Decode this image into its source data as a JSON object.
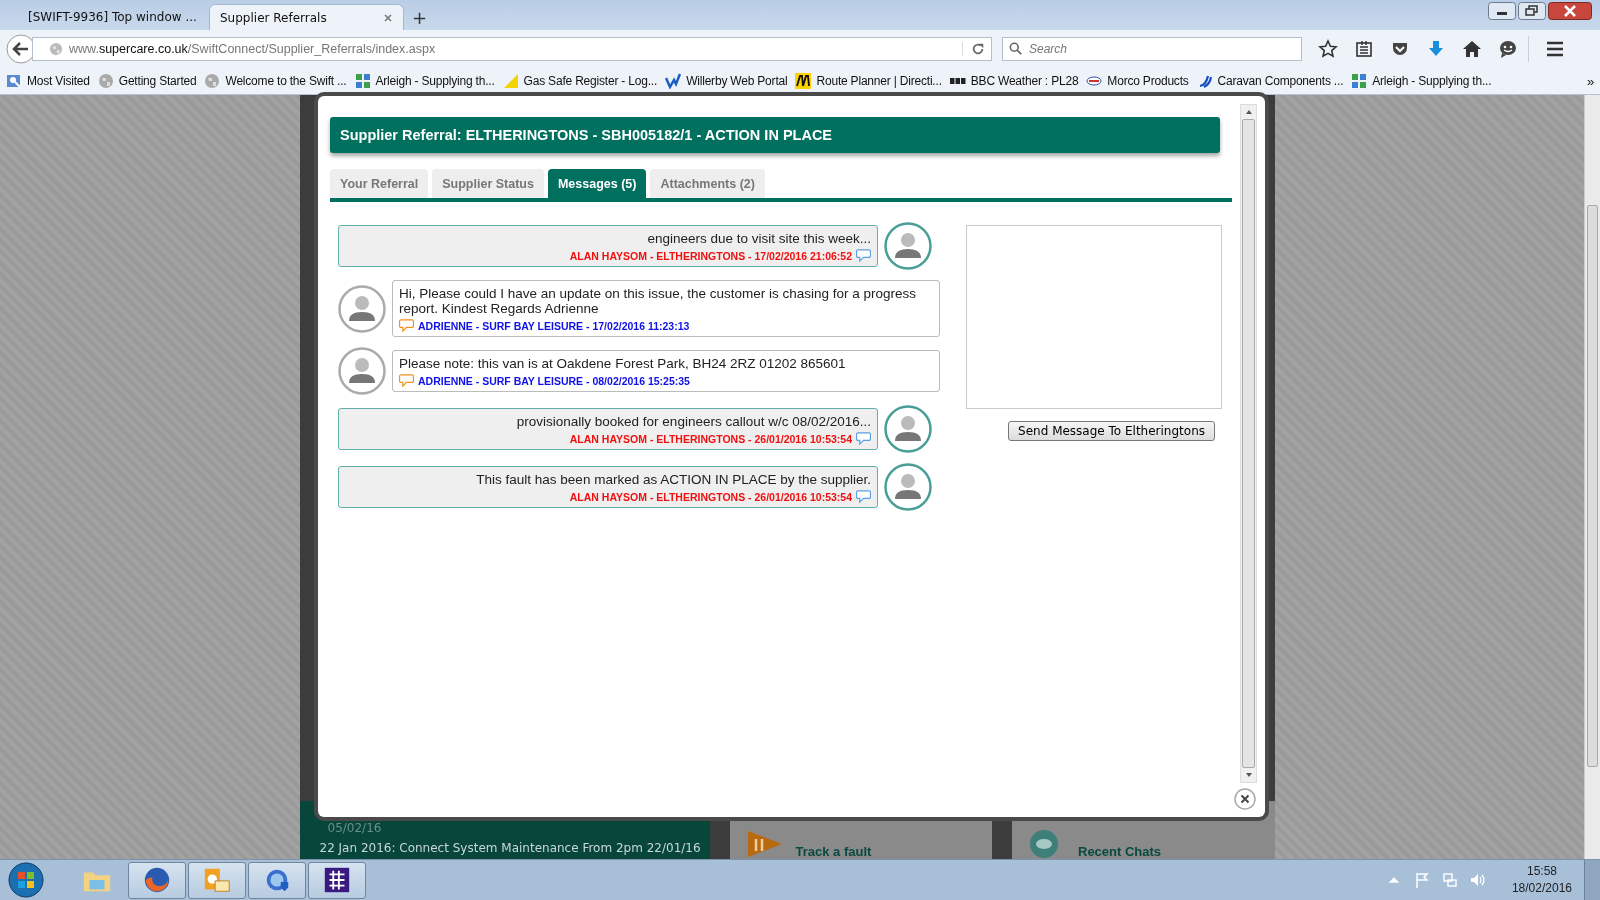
{
  "browser": {
    "tabs": [
      {
        "title": "[SWIFT-9936] Top window ...",
        "selected": false,
        "kind": "icon"
      },
      {
        "title": "Supplier Referrals",
        "selected": true,
        "kind": "plain"
      }
    ],
    "new_tab": "+",
    "url": "www.**supercare.co.uk**/SwiftConnect/Supplier_Referrals/index.aspx",
    "search": {
      "placeholder": "Search"
    },
    "bookmarks": [
      {
        "label": "Most Visited",
        "kind": "person"
      },
      {
        "label": "Getting Started",
        "kind": "globe"
      },
      {
        "label": "Welcome to the Swift ...",
        "kind": "globe"
      },
      {
        "label": "Arleigh - Supplying th...",
        "kind": "tiles"
      },
      {
        "label": "Gas Safe Register - Log...",
        "kind": "gas"
      },
      {
        "label": "Willerby Web Portal",
        "kind": "check"
      },
      {
        "label": "Route Planner | Directi...",
        "kind": "aa"
      },
      {
        "label": "BBC Weather : PL28",
        "kind": "bbc"
      },
      {
        "label": "Morco Products",
        "kind": "badge"
      },
      {
        "label": "Caravan Components ...",
        "kind": "swirl"
      },
      {
        "label": "Arleigh - Supplying th...",
        "kind": "tiles"
      }
    ],
    "bookmarks_more": "»"
  },
  "background_page": {
    "news_date": "05/02/16",
    "news_item": "22 Jan 2016: Connect System Maintenance From 2pm 22/01/16",
    "tiles": [
      {
        "label": "Track a fault",
        "kind": "tools"
      },
      {
        "label": "Recent Chats",
        "kind": "chat"
      }
    ]
  },
  "modal": {
    "title": "Supplier Referral: ELTHERINGTONS - SBH005182/1 - ACTION IN PLACE",
    "tabs": [
      {
        "label": "Your Referral",
        "selected": false
      },
      {
        "label": "Supplier Status",
        "selected": false
      },
      {
        "label": "Messages (5)",
        "selected": true
      },
      {
        "label": "Attachments (2)",
        "selected": false
      }
    ],
    "messages": [
      {
        "kind": "supplier",
        "text": "engineers due to visit site this week...",
        "meta": "ALAN HAYSOM - ELTHERINGTONS - 17/02/2016 21:06:52"
      },
      {
        "kind": "customer",
        "text": "Hi, Please could I have an update on this issue, the customer is chasing for a progress report. Kindest Regards Adrienne",
        "meta": "ADRIENNE - SURF BAY LEISURE - 17/02/2016 11:23:13"
      },
      {
        "kind": "customer",
        "text": "Please note: this van is at Oakdene Forest Park, BH24 2RZ 01202 865601",
        "meta": "ADRIENNE - SURF BAY LEISURE - 08/02/2016 15:25:35"
      },
      {
        "kind": "supplier",
        "text": "provisionally booked for engineers callout w/c 08/02/2016...",
        "meta": "ALAN HAYSOM - ELTHERINGTONS - 26/01/2016 10:53:54"
      },
      {
        "kind": "supplier",
        "text": "This fault has been marked as ACTION IN PLACE by the supplier.",
        "meta": "ALAN HAYSOM - ELTHERINGTONS - 26/01/2016 10:53:54"
      }
    ],
    "reply": {
      "button": "Send Message To Eltheringtons"
    }
  },
  "taskbar": {
    "items": [
      {
        "kind": "folder",
        "running": false
      },
      {
        "kind": "firefox",
        "running": true
      },
      {
        "kind": "outlook",
        "running": true
      },
      {
        "kind": "network",
        "running": true
      },
      {
        "kind": "calendar",
        "running": true
      }
    ],
    "time": "15:58",
    "date": "18/02/2016"
  }
}
